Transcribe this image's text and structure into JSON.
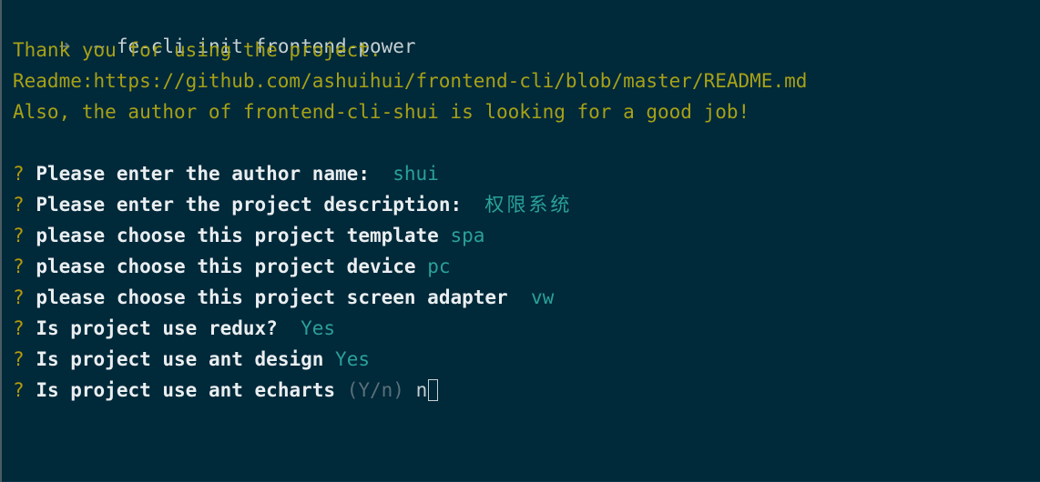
{
  "terminal": {
    "command_prompt": "➜",
    "command_dir": "~",
    "command_text": "fe-cli init frontend-power",
    "intro": [
      "Thank you for using the project.",
      "Readme:https://github.com/ashuihui/frontend-cli/blob/master/README.md",
      "Also, the author of frontend-cli-shui is looking for a good job!"
    ],
    "question_mark": "?",
    "questions": [
      {
        "text": "Please enter the author name:",
        "answer": "shui",
        "sep": "  "
      },
      {
        "text": "Please enter the project description:",
        "answer": "权限系统",
        "sep": "  "
      },
      {
        "text": "please choose this project template",
        "answer": "spa",
        "sep": " "
      },
      {
        "text": "please choose this project device",
        "answer": "pc",
        "sep": " "
      },
      {
        "text": "please choose this project screen adapter",
        "answer": "vw",
        "sep": "  "
      },
      {
        "text": "Is project use redux?",
        "answer": "Yes",
        "sep": "  "
      },
      {
        "text": "Is project use ant design",
        "answer": "Yes",
        "sep": " "
      }
    ],
    "pending_question": {
      "text": "Is project use ant echarts",
      "hint": "(Y/n)",
      "typed": "n"
    }
  },
  "colors": {
    "background": "#00293a",
    "intro_text": "#a7a116",
    "answer": "#2aa198",
    "question_text": "#eaeef0",
    "hint": "#5b7079"
  }
}
